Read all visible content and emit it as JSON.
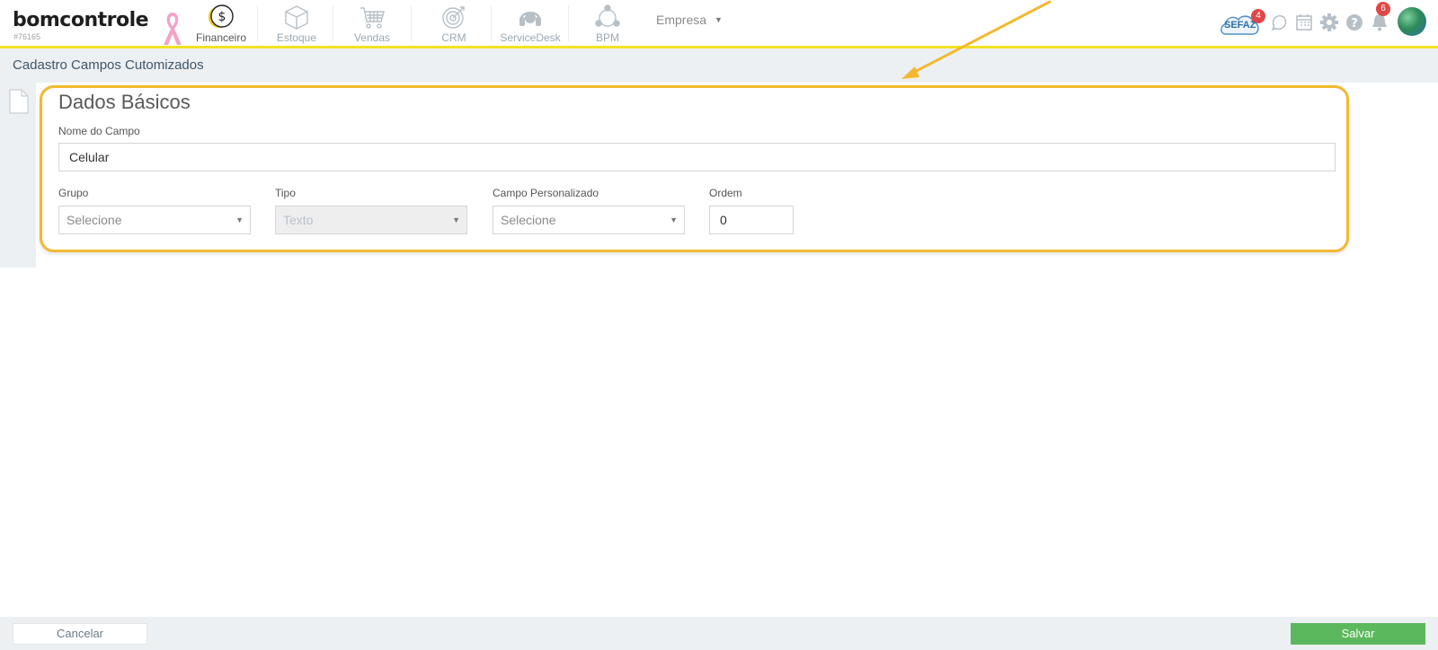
{
  "app": {
    "logo_text": "bomcontrole",
    "account_id": "#76165"
  },
  "nav": [
    {
      "label": "Financeiro",
      "icon": "dollar-coin-icon",
      "active": true
    },
    {
      "label": "Estoque",
      "icon": "box-icon",
      "active": false
    },
    {
      "label": "Vendas",
      "icon": "cart-icon",
      "active": false
    },
    {
      "label": "CRM",
      "icon": "target-icon",
      "active": false
    },
    {
      "label": "ServiceDesk",
      "icon": "headset-icon",
      "active": false
    },
    {
      "label": "BPM",
      "icon": "flow-icon",
      "active": false
    }
  ],
  "company_menu": {
    "label": "Empresa",
    "caret": "▼"
  },
  "header_right": {
    "sefaz_label": "SEFAZ",
    "sefaz_badge": "4",
    "notifications_badge": "6",
    "icons": [
      "whatsapp-icon",
      "calendar-icon",
      "gear-icon",
      "help-icon",
      "bell-icon",
      "avatar"
    ]
  },
  "page": {
    "title": "Cadastro Campos Cutomizados"
  },
  "form": {
    "section_title": "Dados Básicos",
    "nome_label": "Nome do Campo",
    "nome_value": "Celular",
    "grupo_label": "Grupo",
    "grupo_value": "Selecione",
    "tipo_label": "Tipo",
    "tipo_value": "Texto",
    "campo_label": "Campo Personalizado",
    "campo_value": "Selecione",
    "ordem_label": "Ordem",
    "ordem_value": "0",
    "select_caret": "▼"
  },
  "footer": {
    "cancel_label": "Cancelar",
    "save_label": "Salvar"
  },
  "colors": {
    "accent_yellow": "#f2e224",
    "highlight_orange": "#f2b930",
    "save_green": "#5cb85c",
    "badge_red": "#e04848"
  }
}
